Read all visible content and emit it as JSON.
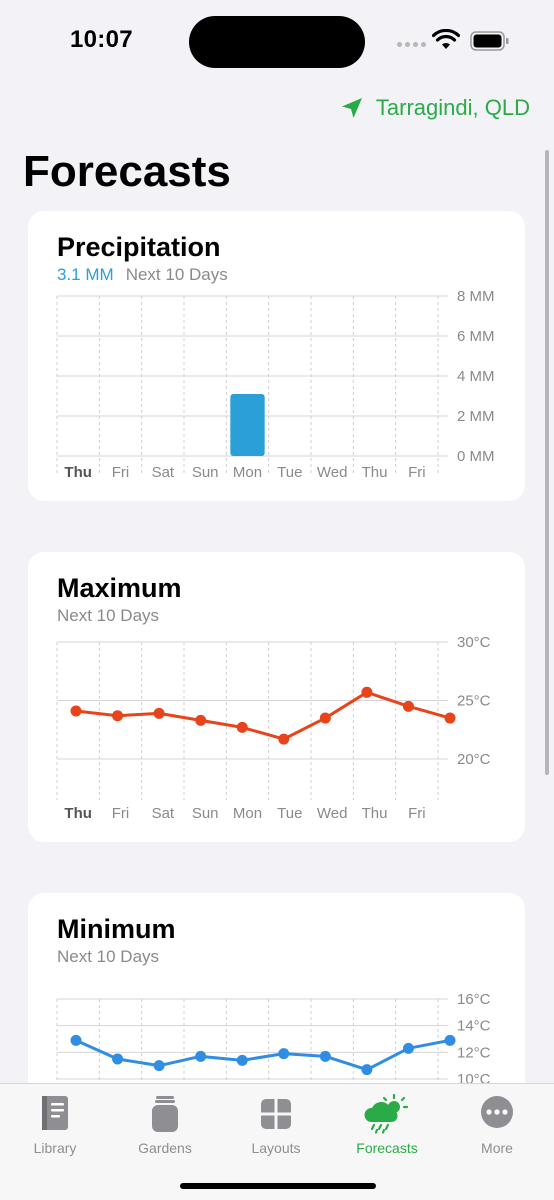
{
  "status": {
    "time": "10:07"
  },
  "location": {
    "label": "Tarragindi, QLD",
    "icon": "location-arrow-icon",
    "color": "#2bab48"
  },
  "page": {
    "title": "Forecasts"
  },
  "days": [
    "Thu",
    "Fri",
    "Sat",
    "Sun",
    "Mon",
    "Tue",
    "Wed",
    "Thu",
    "Fri"
  ],
  "precipitation": {
    "title": "Precipitation",
    "total": "3.1 MM",
    "subtitle": "Next 10 Days",
    "y_labels": [
      "8 MM",
      "6 MM",
      "4 MM",
      "2 MM",
      "0 MM"
    ],
    "color": "#2a9fd8"
  },
  "maximum": {
    "title": "Maximum",
    "subtitle": "Next 10 Days",
    "y_labels": [
      "30°C",
      "25°C",
      "20°C"
    ],
    "color": "#e8431a"
  },
  "minimum": {
    "title": "Minimum",
    "subtitle": "Next 10 Days",
    "y_labels": [
      "16°C",
      "14°C",
      "12°C",
      "10°C"
    ],
    "color": "#2f8de4"
  },
  "chart_data": [
    {
      "type": "bar",
      "title": "Precipitation",
      "categories": [
        "Thu",
        "Fri",
        "Sat",
        "Sun",
        "Mon",
        "Tue",
        "Wed",
        "Thu",
        "Fri"
      ],
      "values": [
        0,
        0,
        0,
        0,
        3.1,
        0,
        0,
        0,
        0
      ],
      "ylabel": "MM",
      "ylim": [
        0,
        8
      ],
      "grid": true
    },
    {
      "type": "line",
      "title": "Maximum",
      "categories": [
        "Thu",
        "Fri",
        "Sat",
        "Sun",
        "Mon",
        "Tue",
        "Wed",
        "Thu",
        "Fri"
      ],
      "values": [
        24.1,
        23.7,
        23.9,
        23.3,
        22.7,
        21.7,
        23.5,
        25.7,
        24.5,
        23.5
      ],
      "ylabel": "°C",
      "ylim": [
        20,
        30
      ],
      "grid": true
    },
    {
      "type": "line",
      "title": "Minimum",
      "categories": [
        "Thu",
        "Fri",
        "Sat",
        "Sun",
        "Mon",
        "Tue",
        "Wed",
        "Thu",
        "Fri"
      ],
      "values": [
        12.9,
        11.5,
        11.0,
        11.7,
        11.4,
        11.9,
        11.7,
        10.7,
        12.3,
        12.9
      ],
      "ylabel": "°C",
      "ylim": [
        10,
        16
      ],
      "grid": true
    }
  ],
  "tabs": [
    {
      "label": "Library",
      "icon": "book-icon",
      "active": false
    },
    {
      "label": "Gardens",
      "icon": "jar-icon",
      "active": false
    },
    {
      "label": "Layouts",
      "icon": "grid-icon",
      "active": false
    },
    {
      "label": "Forecasts",
      "icon": "cloud-sun-rain-icon",
      "active": true
    },
    {
      "label": "More",
      "icon": "ellipsis-circle-icon",
      "active": false
    }
  ]
}
